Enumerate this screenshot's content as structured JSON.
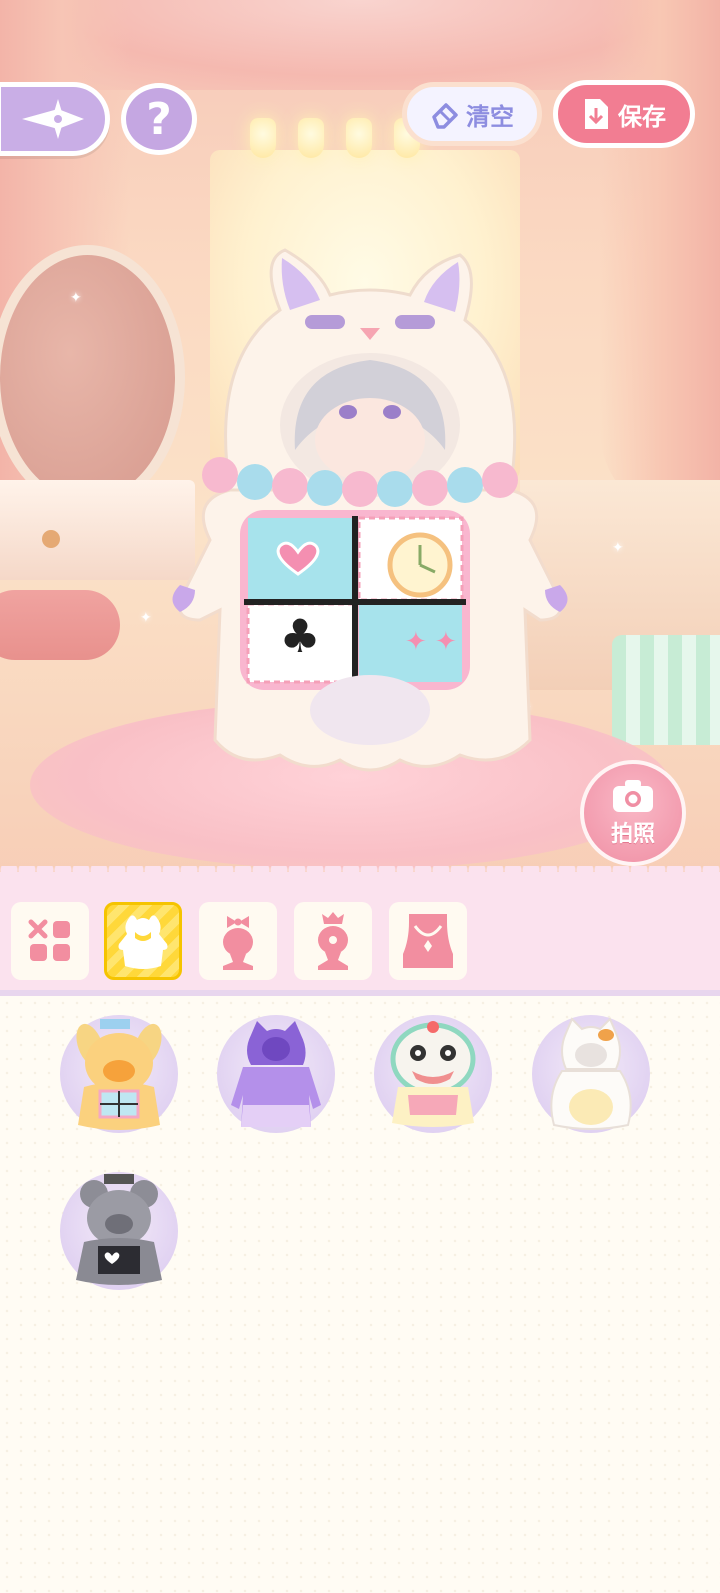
{
  "header": {
    "clear_label": "清空",
    "save_label": "保存",
    "help_glyph": "?"
  },
  "scene": {
    "photo_label": "拍照"
  },
  "categories": [
    {
      "name": "all",
      "icon": "grid-icon",
      "active": false
    },
    {
      "name": "full-costume",
      "icon": "costume-icon",
      "active": true
    },
    {
      "name": "headwear",
      "icon": "bow-head-icon",
      "active": false
    },
    {
      "name": "hair-accessory",
      "icon": "head-accessory-icon",
      "active": false
    },
    {
      "name": "necklace",
      "icon": "necklace-icon",
      "active": false
    }
  ],
  "items": [
    {
      "name": "yellow-dog-costume",
      "icon": "yellow-dog-costume-icon"
    },
    {
      "name": "purple-cat-hoodie",
      "icon": "purple-cat-hoodie-icon"
    },
    {
      "name": "lion-dance-costume",
      "icon": "lion-dance-costume-icon"
    },
    {
      "name": "calico-cat-costume",
      "icon": "calico-cat-costume-icon"
    },
    {
      "name": "gray-mouse-costume",
      "icon": "gray-mouse-costume-icon"
    }
  ],
  "colors": {
    "accent_pink": "#f27d92",
    "accent_purple": "#c5a7e2",
    "active_tab": "#ffd83a",
    "icon_pink": "#f28ea0"
  }
}
